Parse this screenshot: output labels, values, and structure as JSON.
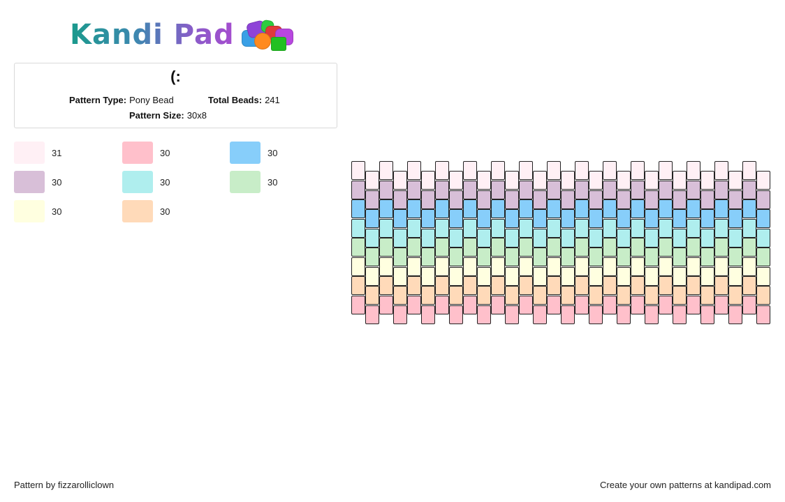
{
  "logo": {
    "text": "Kandi Pad",
    "icon": "bead-pile-icon"
  },
  "pattern": {
    "title": "(:",
    "type_label": "Pattern Type:",
    "type_value": "Pony Bead",
    "beads_label": "Total Beads:",
    "beads_value": "241",
    "size_label": "Pattern Size:",
    "size_value": "30x8"
  },
  "legend": [
    {
      "color": "#FFF0F5",
      "count": "31"
    },
    {
      "color": "#FFC0CB",
      "count": "30"
    },
    {
      "color": "#87CEFA",
      "count": "30"
    },
    {
      "color": "#D8BFD8",
      "count": "30"
    },
    {
      "color": "#AFEEEE",
      "count": "30"
    },
    {
      "color": "#C8EDC8",
      "count": "30"
    },
    {
      "color": "#FFFFE0",
      "count": "30"
    },
    {
      "color": "#FFDAB9",
      "count": "30"
    }
  ],
  "grid": {
    "columns": 30,
    "rows": 8,
    "row_colors": [
      "#FFF0F5",
      "#D8BFD8",
      "#87CEFA",
      "#AFEEEE",
      "#C8EDC8",
      "#FFFFE0",
      "#FFDAB9",
      "#FFC0CB"
    ]
  },
  "footer": {
    "left": "Pattern by fizzarolliclown",
    "right": "Create your own patterns at kandipad.com"
  }
}
